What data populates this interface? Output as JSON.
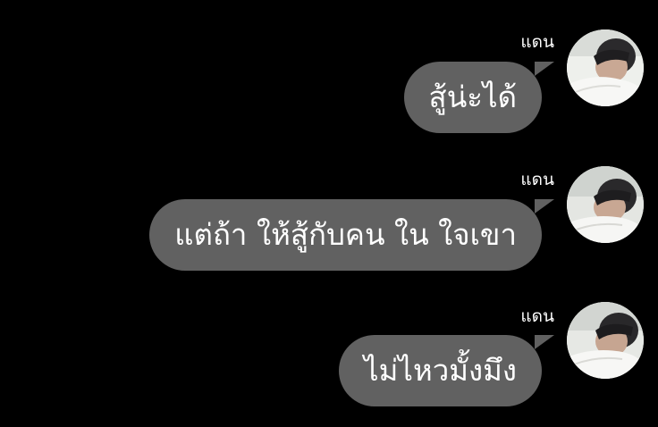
{
  "messages": [
    {
      "sender": "แดน",
      "text": "สู้น่ะได้",
      "avatar_icon": "user-avatar-photo"
    },
    {
      "sender": "แดน",
      "text": "แต่ถ้า ให้สู้กับคน ใน ใจเขา",
      "avatar_icon": "user-avatar-photo"
    },
    {
      "sender": "แดน",
      "text": "ไม่ไหวมั้งมึง",
      "avatar_icon": "user-avatar-photo"
    }
  ],
  "colors": {
    "background": "#000000",
    "bubble": "#616161",
    "text": "#ffffff"
  }
}
